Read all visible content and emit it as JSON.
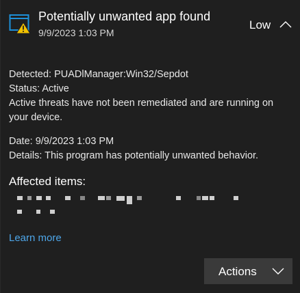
{
  "header": {
    "title": "Potentially unwanted app found",
    "datetime": "9/9/2023 1:03 PM",
    "severity": "Low"
  },
  "details": {
    "detected_label": "Detected:",
    "detected_value": "PUADlManager:Win32/Sepdot",
    "status_label": "Status:",
    "status_value": "Active",
    "status_message": "Active threats have not been remediated and are running on your device.",
    "date_label": "Date:",
    "date_value": "9/9/2023 1:03 PM",
    "details_label": "Details:",
    "details_value": "This program has potentially unwanted behavior."
  },
  "affected": {
    "title": "Affected items:"
  },
  "links": {
    "learn_more": "Learn more"
  },
  "actions": {
    "label": "Actions"
  },
  "icons": {
    "app": "windows-security-warning-icon",
    "collapse": "chevron-up-icon",
    "actions": "chevron-down-icon"
  },
  "colors": {
    "background": "#1f1f1f",
    "link": "#4ea7ea",
    "button": "#3a3a3a",
    "icon_blue": "#1e90d8",
    "warning": "#f2c200"
  }
}
